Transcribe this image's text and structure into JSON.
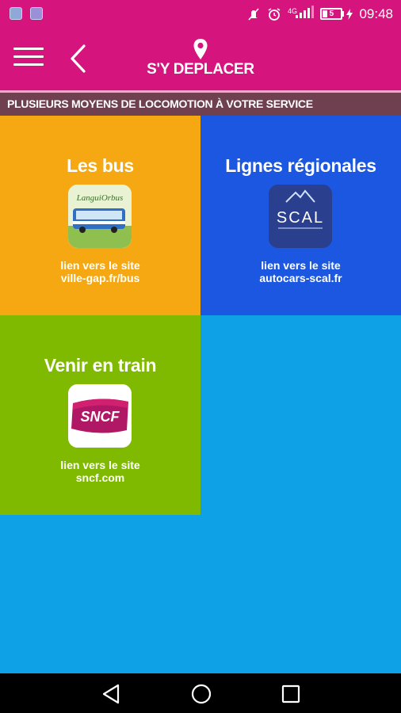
{
  "status_bar": {
    "time": "09:48",
    "network": "4G",
    "battery": "5"
  },
  "header": {
    "title": "S'Y DEPLACER"
  },
  "banner": {
    "text": "PLUSIEURS MOYENS DE LOCOMOTION À VOTRE SERVICE"
  },
  "tiles": [
    {
      "title": "Les bus",
      "logo_text": "LanguiOrbus",
      "link_line1": "lien vers le site",
      "link_line2": "ville-gap.fr/bus",
      "color": "#f5a811"
    },
    {
      "title": "Lignes régionales",
      "logo_text": "SCAL",
      "link_line1": "lien vers le site",
      "link_line2": "autocars-scal.fr",
      "color": "#1b57e0"
    },
    {
      "title": "Venir en train",
      "logo_text": "SNCF",
      "link_line1": "lien vers le site",
      "link_line2": "sncf.com",
      "color": "#7fba00"
    }
  ],
  "colors": {
    "brand": "#d5157d",
    "banner": "#6e4050",
    "background": "#0ea1e6"
  }
}
